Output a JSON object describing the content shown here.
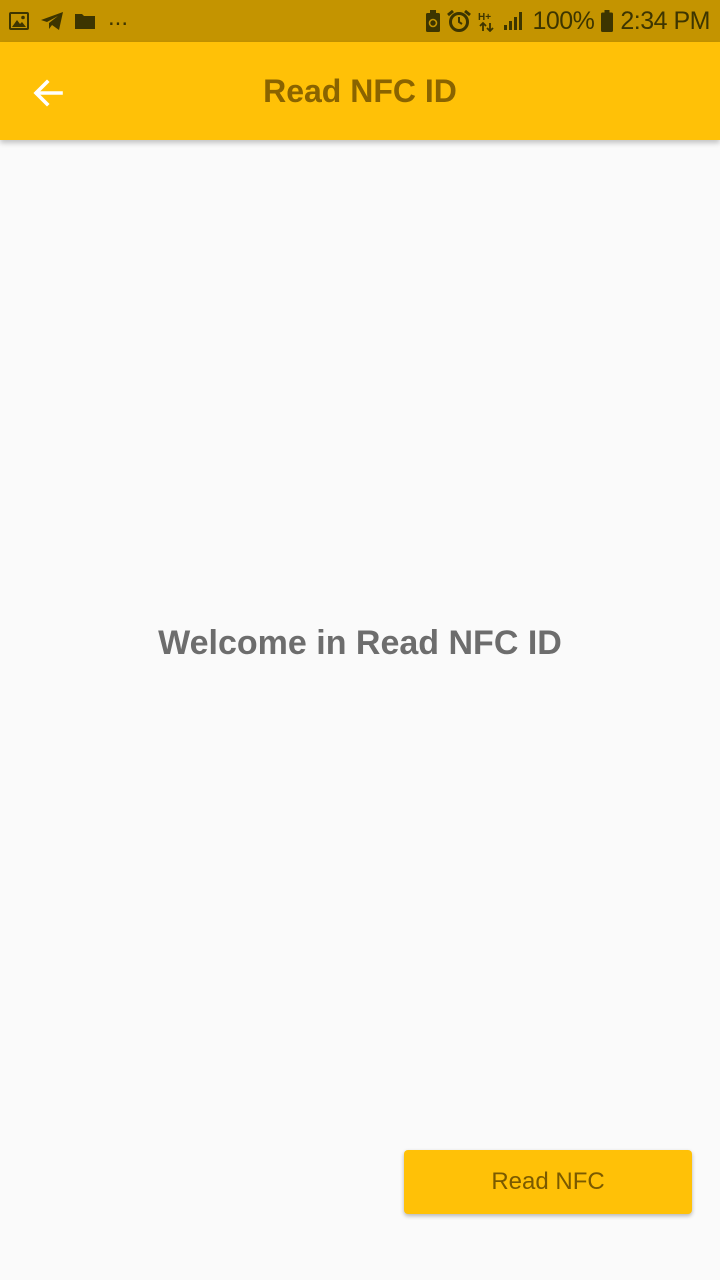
{
  "status_bar": {
    "left_icons": [
      "image-icon",
      "telegram-icon",
      "folder-icon"
    ],
    "overflow": "...",
    "right_icons": [
      "battery-saver-icon",
      "alarm-icon",
      "network-hplus-icon",
      "signal-icon",
      "battery-icon"
    ],
    "battery": "100%",
    "time": "2:34 PM",
    "color": "#c49400"
  },
  "app_bar": {
    "title": "Read NFC ID",
    "back_icon": "arrow-left-icon",
    "color": "#ffc107"
  },
  "main": {
    "welcome_text": "Welcome in Read NFC ID"
  },
  "actions": {
    "read_button_label": "Read NFC"
  }
}
